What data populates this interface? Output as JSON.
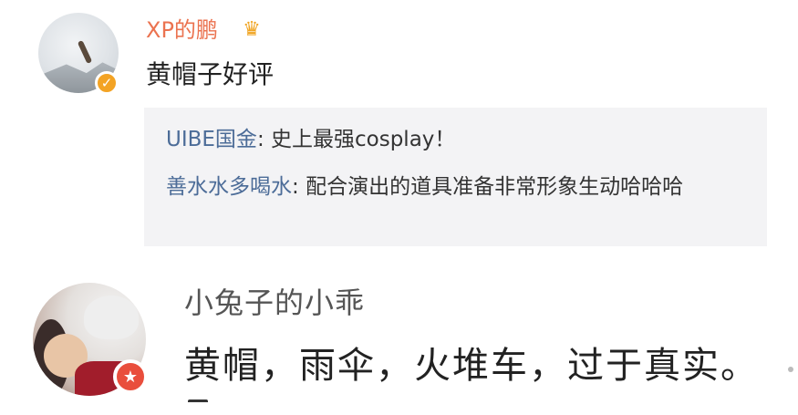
{
  "comment1": {
    "username": "XP的鹏",
    "badge_icon": "crown-icon",
    "verified_icon": "verified-icon",
    "text": "黄帽子好评",
    "replies": [
      {
        "name": "UIBE国金",
        "sep": ": ",
        "text": "史上最强cosplay！"
      },
      {
        "name": "善水水多喝水",
        "sep": ": ",
        "text": "配合演出的道具准备非常形象生动哈哈哈"
      }
    ]
  },
  "comment2": {
    "username": "小兔子的小乖",
    "text": "黄帽，雨伞，火堆车，过于真实。",
    "badge_icon": "star-badge-icon"
  },
  "colors": {
    "username_orange": "#eb7350",
    "reply_name_blue": "#4c6c98",
    "reply_bg": "#f3f3f5",
    "verified_orange": "#f3a324",
    "badge_red": "#e94e3c"
  }
}
